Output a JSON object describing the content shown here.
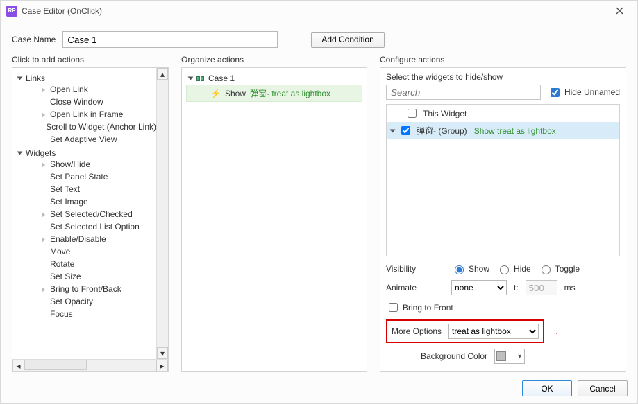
{
  "window": {
    "title": "Case Editor (OnClick)"
  },
  "caseName": {
    "label": "Case Name",
    "value": "Case 1"
  },
  "addCondition": "Add Condition",
  "columns": {
    "actions": "Click to add actions",
    "organize": "Organize actions",
    "configure": "Configure actions"
  },
  "actionTree": {
    "groups": [
      {
        "label": "Links",
        "items": [
          {
            "label": "Open Link",
            "exp": true
          },
          {
            "label": "Close Window",
            "exp": false
          },
          {
            "label": "Open Link in Frame",
            "exp": true
          },
          {
            "label": "Scroll to Widget (Anchor Link)",
            "exp": false
          },
          {
            "label": "Set Adaptive View",
            "exp": false
          }
        ]
      },
      {
        "label": "Widgets",
        "items": [
          {
            "label": "Show/Hide",
            "exp": true
          },
          {
            "label": "Set Panel State",
            "exp": false
          },
          {
            "label": "Set Text",
            "exp": false
          },
          {
            "label": "Set Image",
            "exp": false
          },
          {
            "label": "Set Selected/Checked",
            "exp": true
          },
          {
            "label": "Set Selected List Option",
            "exp": false
          },
          {
            "label": "Enable/Disable",
            "exp": true
          },
          {
            "label": "Move",
            "exp": false
          },
          {
            "label": "Rotate",
            "exp": false
          },
          {
            "label": "Set Size",
            "exp": false
          },
          {
            "label": "Bring to Front/Back",
            "exp": true
          },
          {
            "label": "Set Opacity",
            "exp": false
          },
          {
            "label": "Focus",
            "exp": false
          }
        ]
      }
    ]
  },
  "organize": {
    "caseLabel": "Case 1",
    "action": {
      "verb": "Show",
      "target": "弹窗-",
      "suffix": " treat as lightbox"
    }
  },
  "configure": {
    "subLabel": "Select the widgets to hide/show",
    "searchPlaceholder": "Search",
    "hideUnnamed": "Hide Unnamed",
    "widgets": [
      {
        "label": "This Widget",
        "checked": false,
        "selected": false
      },
      {
        "label": "弹窗- (Group)",
        "checked": true,
        "selected": true,
        "note": "Show treat as lightbox"
      }
    ],
    "visibility": {
      "label": "Visibility",
      "options": [
        "Show",
        "Hide",
        "Toggle"
      ],
      "selected": "Show"
    },
    "animate": {
      "label": "Animate",
      "value": "none",
      "tLabel": "t:",
      "tValue": "500",
      "unit": "ms"
    },
    "bringToFront": "Bring to Front",
    "moreOptions": {
      "label": "More Options",
      "value": "treat as lightbox"
    },
    "bgColor": "Background Color"
  },
  "buttons": {
    "ok": "OK",
    "cancel": "Cancel"
  }
}
